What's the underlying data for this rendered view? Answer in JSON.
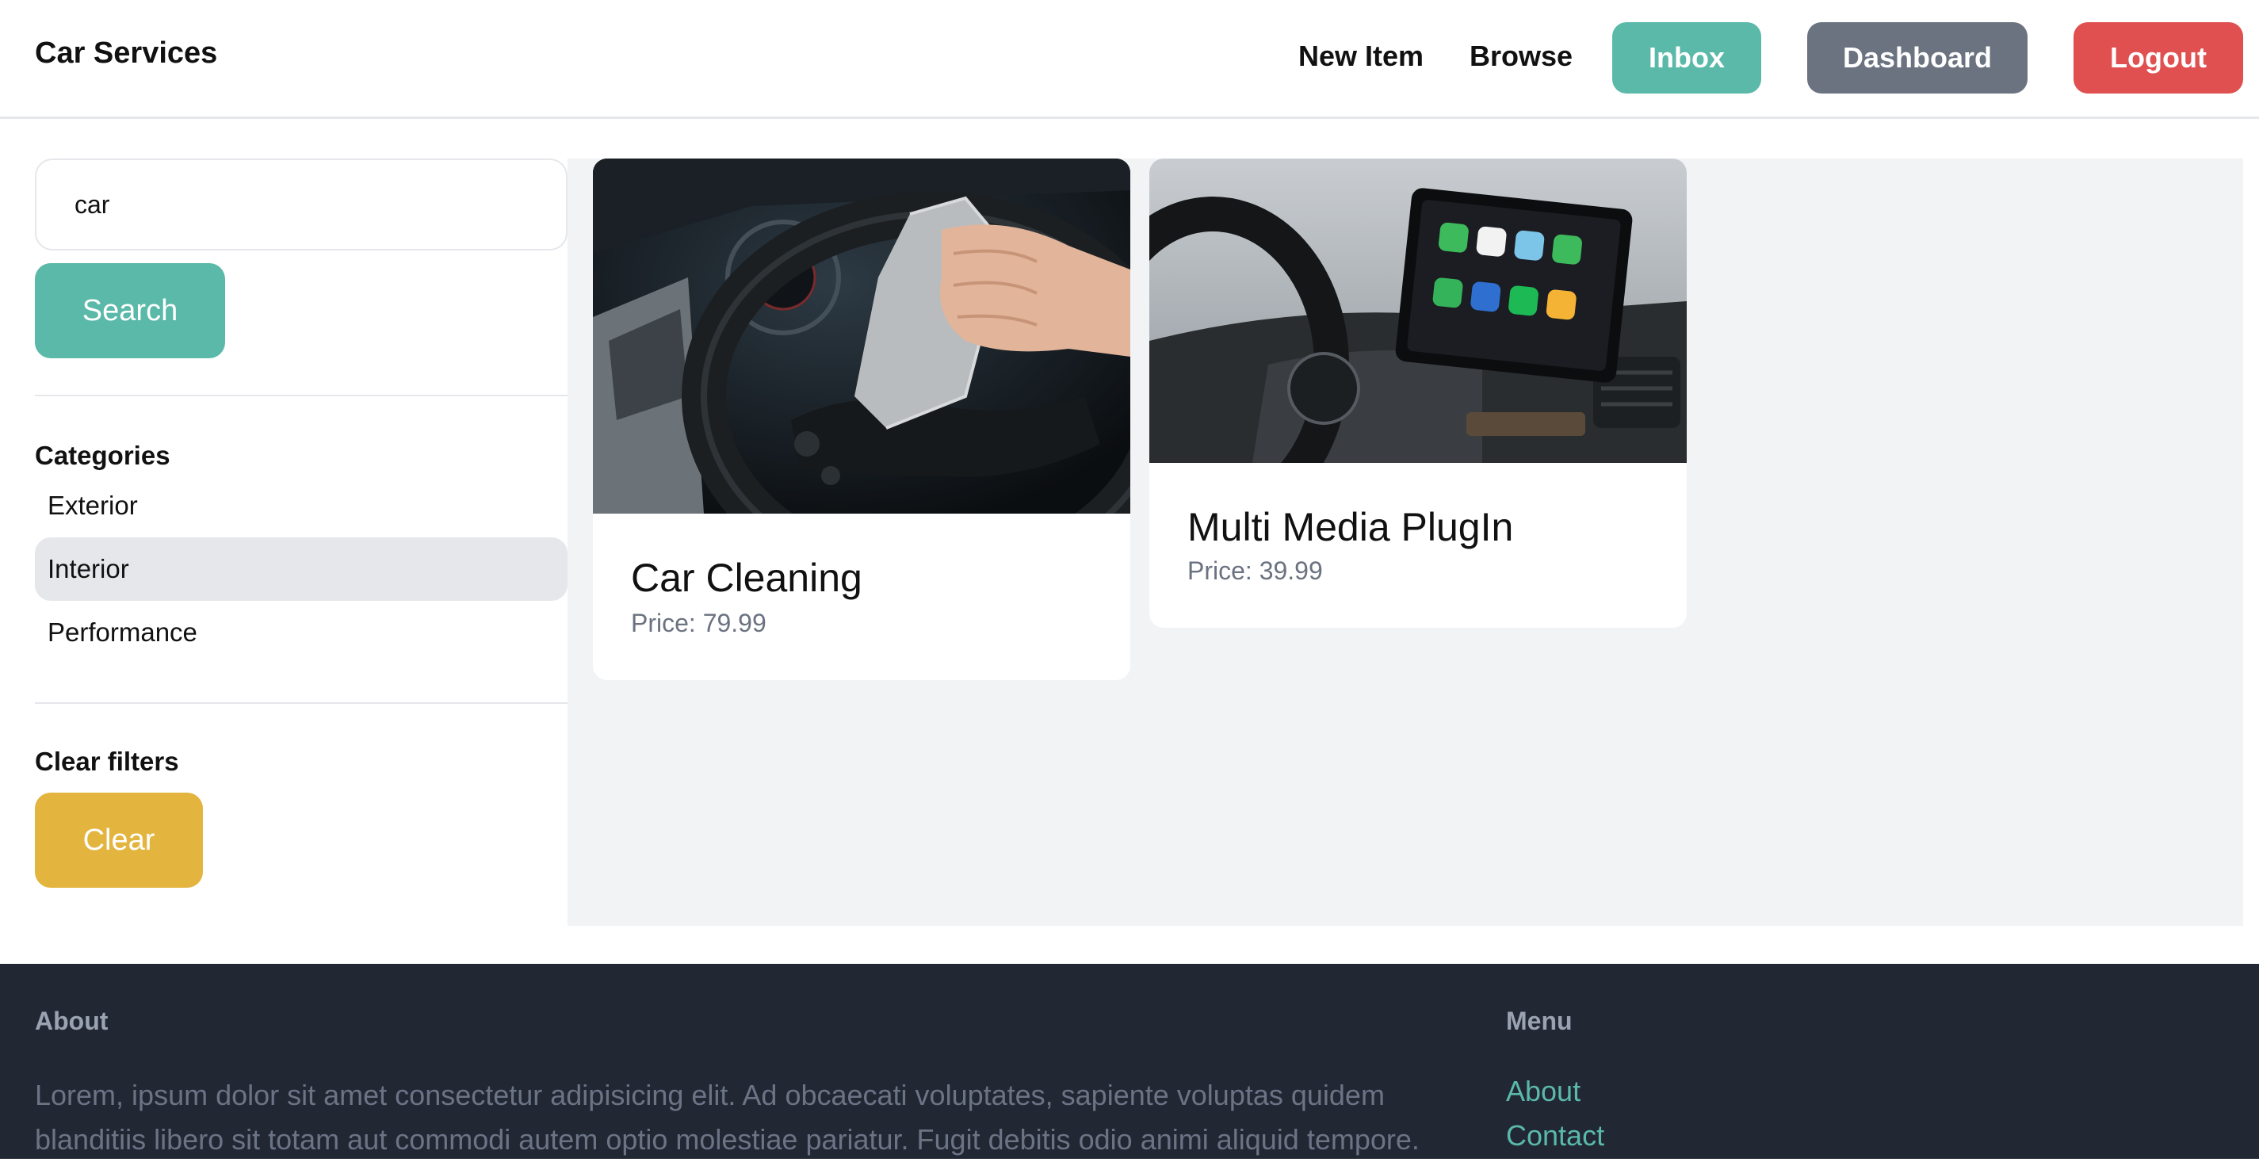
{
  "navbar": {
    "brand": "Car Services",
    "links": [
      "New Item",
      "Browse"
    ],
    "buttons": {
      "inbox": "Inbox",
      "dashboard": "Dashboard",
      "logout": "Logout"
    }
  },
  "search": {
    "value": "car",
    "button_label": "Search"
  },
  "categories": {
    "title": "Categories",
    "items": [
      "Exterior",
      "Interior",
      "Performance"
    ],
    "active": "Interior"
  },
  "filters": {
    "title": "Clear filters",
    "button_label": "Clear"
  },
  "items": [
    {
      "title": "Car Cleaning",
      "price": "Price: 79.99"
    },
    {
      "title": "Multi Media PlugIn",
      "price": "Price: 39.99"
    }
  ],
  "footer": {
    "about_heading": "About",
    "about_text": "Lorem, ipsum dolor sit amet consectetur adipisicing elit. Ad obcaecati voluptates, sapiente voluptas quidem blanditiis libero sit totam aut commodi autem optio molestiae pariatur. Fugit debitis odio animi aliquid tempore.",
    "menu_heading": "Menu",
    "menu_links": [
      "About",
      "Contact"
    ]
  },
  "colors": {
    "accent": "#5ab9a8",
    "dashboard": "#6b7280",
    "logout": "#e05050",
    "clear": "#e3b53f",
    "footer_bg": "#222734"
  }
}
